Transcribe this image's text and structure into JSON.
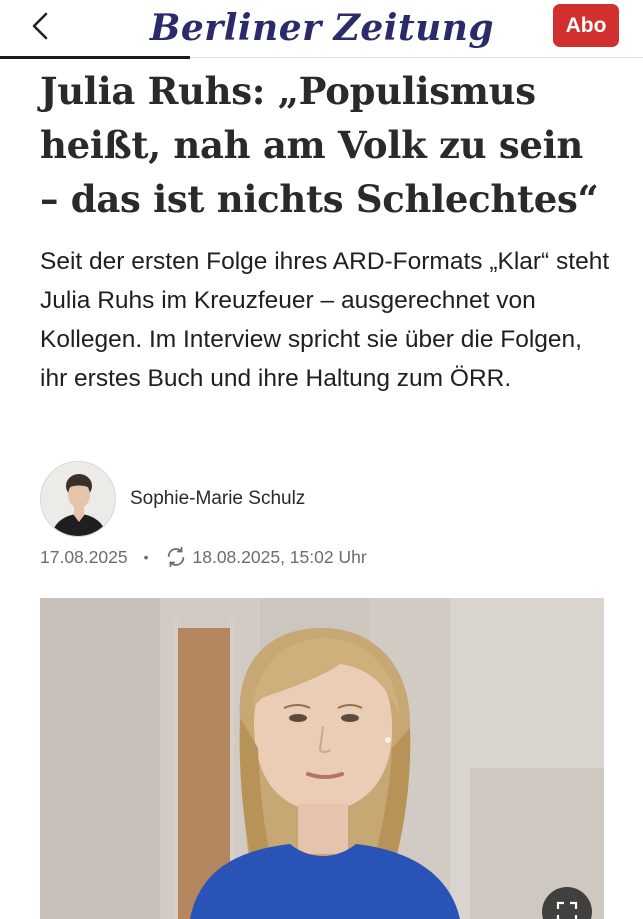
{
  "header": {
    "logo_left": "Berliner",
    "logo_right": "Zeitung",
    "abo_label": "Abo",
    "back_icon": "chevron-left-icon"
  },
  "article": {
    "headline": "Julia Ruhs: „Populismus heißt, nah am Volk zu sein – das ist nichts Schlechtes“",
    "lead": "Seit der ersten Folge ihres ARD-Formats „Klar“ steht Julia Ruhs im Kreuzfeuer – ausgerechnet von Kollegen. Im Interview spricht sie über die Folgen, ihr erstes Buch und ihre Haltung zum ÖRR.",
    "author": "Sophie-Marie Schulz",
    "published": "17.08.2025",
    "separator": "•",
    "updated": "18.08.2025, 15:02 Uhr"
  },
  "colors": {
    "brand_blue": "#2b2b6b",
    "brand_red": "#c62828",
    "abo_red": "#d22f2f",
    "meta_gray": "#6c6c6c"
  }
}
